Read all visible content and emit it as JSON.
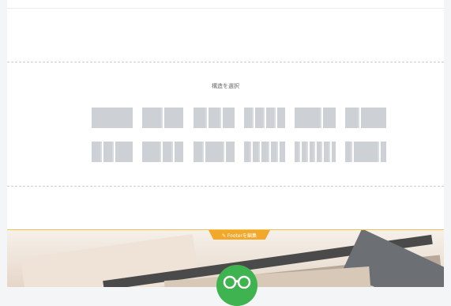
{
  "structure_picker": {
    "title": "構造を選択",
    "layouts": [
      {
        "name": "1 col",
        "cols": 1
      },
      {
        "name": "2 col",
        "cols": 2
      },
      {
        "name": "3 col",
        "cols": 3
      },
      {
        "name": "4 col",
        "cols": 4
      },
      {
        "name": "2 col (1:2)",
        "cols": 2
      },
      {
        "name": "2 col (2:1)",
        "cols": 2
      },
      {
        "name": "3 col alt",
        "cols": 3
      },
      {
        "name": "3 col alt 2",
        "cols": 3
      },
      {
        "name": "4 col alt",
        "cols": 4
      },
      {
        "name": "5 col",
        "cols": 5
      },
      {
        "name": "6 col",
        "cols": 6
      },
      {
        "name": "3 col narrow-sides",
        "cols": 3
      }
    ]
  },
  "footer": {
    "edit_label": "✎ Footerを編集"
  },
  "colors": {
    "accent": "#f1a82b",
    "tile": "#cdd1d5",
    "logo_green": "#3fb34f"
  }
}
